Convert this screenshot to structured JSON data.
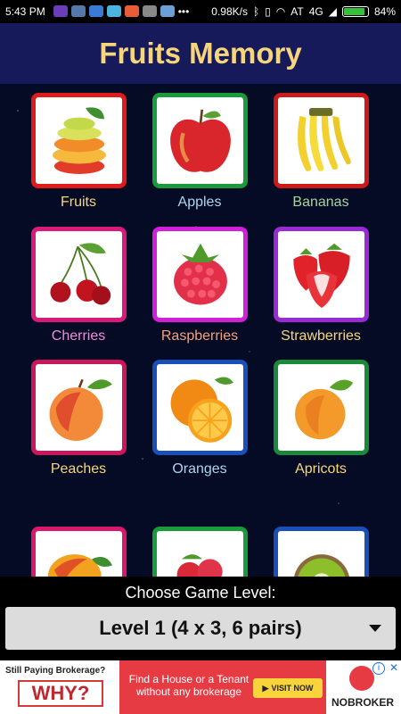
{
  "status_bar": {
    "time": "5:43 PM",
    "speed": "0.98K/s",
    "carrier": "AT",
    "network": "4G",
    "battery": "84%"
  },
  "app": {
    "title": "Fruits Memory"
  },
  "cards": [
    {
      "label": "Fruits",
      "border": "#e01b1b",
      "label_color": "#f7d67a",
      "icon": "fruit-stack-icon"
    },
    {
      "label": "Apples",
      "border": "#1a9a3a",
      "label_color": "#a9d7ee",
      "icon": "apple-icon"
    },
    {
      "label": "Bananas",
      "border": "#cc1a1a",
      "label_color": "#a6d49f",
      "icon": "banana-icon"
    },
    {
      "label": "Cherries",
      "border": "#d81b7a",
      "label_color": "#f08ed9",
      "icon": "cherry-icon"
    },
    {
      "label": "Raspberries",
      "border": "#d21fd8",
      "label_color": "#f7a078",
      "icon": "raspberry-icon"
    },
    {
      "label": "Strawberries",
      "border": "#9a2ad4",
      "label_color": "#f7d67a",
      "icon": "strawberry-icon"
    },
    {
      "label": "Peaches",
      "border": "#c8185a",
      "label_color": "#f7d67a",
      "icon": "peach-icon"
    },
    {
      "label": "Oranges",
      "border": "#1b4fb8",
      "label_color": "#a9d7ee",
      "icon": "orange-icon"
    },
    {
      "label": "Apricots",
      "border": "#1a8a3a",
      "label_color": "#f7d67a",
      "icon": "apricot-icon"
    },
    {
      "label": "",
      "border": "#d8186a",
      "label_color": "#f7d67a",
      "icon": "mango-icon"
    },
    {
      "label": "",
      "border": "#1a9a3a",
      "label_color": "#f7d67a",
      "icon": "lychee-icon"
    },
    {
      "label": "",
      "border": "#1b4fb8",
      "label_color": "#f7d67a",
      "icon": "kiwi-icon"
    }
  ],
  "level": {
    "title": "Choose Game Level:",
    "selected": "Level 1 (4 x 3, 6 pairs)"
  },
  "ad": {
    "question": "Still Paying Brokerage?",
    "why": "WHY?",
    "headline": "Find a House or a Tenant without any brokerage",
    "button": "VISIT NOW",
    "brand": "NOBROKER"
  }
}
